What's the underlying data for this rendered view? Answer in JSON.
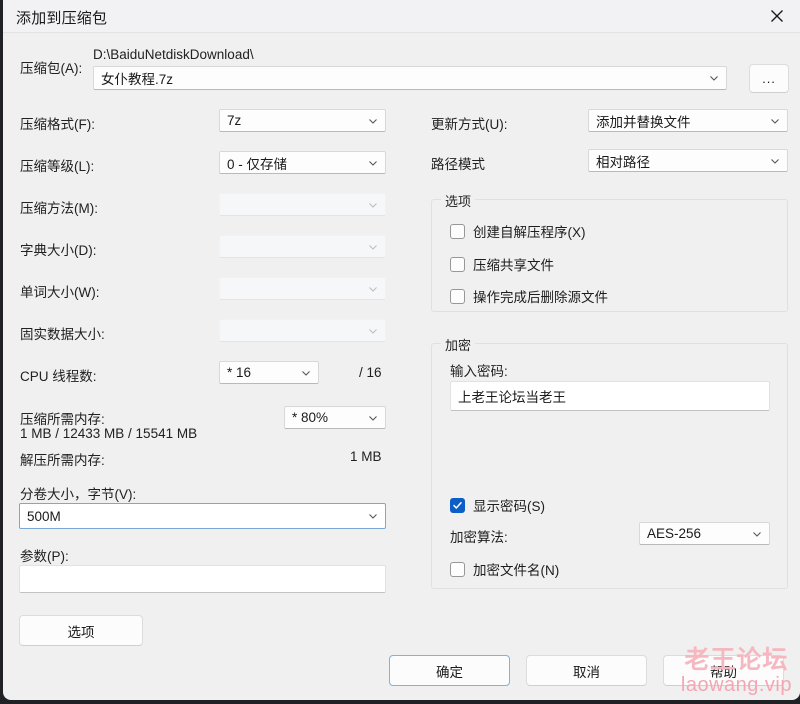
{
  "window": {
    "title": "添加到压缩包",
    "close_icon": "close-icon"
  },
  "archive": {
    "label": "压缩包(A):",
    "path": "D:\\BaiduNetdiskDownload\\",
    "filename": "女仆教程.7z",
    "browse_label": "...",
    "chevron_icon": "chevron-down-icon"
  },
  "left": {
    "format_label": "压缩格式(F):",
    "format_value": "7z",
    "level_label": "压缩等级(L):",
    "level_value": "0 - 仅存储",
    "method_label": "压缩方法(M):",
    "method_value": "",
    "dict_label": "字典大小(D):",
    "dict_value": "",
    "word_label": "单词大小(W):",
    "word_value": "",
    "solid_label": "固实数据大小:",
    "solid_value": "",
    "cpu_label": "CPU 线程数:",
    "cpu_value": "*  16",
    "cpu_total": "/ 16",
    "mem_compress_label": "压缩所需内存:",
    "mem_compress_value": "1 MB / 12433 MB / 15541 MB",
    "mem_percent_value": "*  80%",
    "mem_extract_label": "解压所需内存:",
    "mem_extract_value": "1 MB",
    "volume_label": "分卷大小，字节(V):",
    "volume_value": "500M",
    "params_label": "参数(P):",
    "params_value": "",
    "options_button": "选项"
  },
  "right": {
    "update_label": "更新方式(U):",
    "update_value": "添加并替换文件",
    "path_mode_label": "路径模式",
    "path_mode_value": "相对路径",
    "options_group_title": "选项",
    "options_checkboxes": [
      {
        "label": "创建自解压程序(X)",
        "checked": false
      },
      {
        "label": "压缩共享文件",
        "checked": false
      },
      {
        "label": "操作完成后删除源文件",
        "checked": false
      }
    ],
    "encryption_group_title": "加密",
    "password_label": "输入密码:",
    "password_value": "上老王论坛当老王",
    "show_password_label": "显示密码(S)",
    "show_password_checked": true,
    "algorithm_label": "加密算法:",
    "algorithm_value": "AES-256",
    "encrypt_names_label": "加密文件名(N)",
    "encrypt_names_checked": false
  },
  "footer": {
    "ok_label": "确定",
    "cancel_label": "取消",
    "help_label": "帮助"
  },
  "watermark": {
    "line1": "老王论坛",
    "line2": "laowang.vip",
    "color1": "#f6b8c0",
    "color2": "#f3a7b4"
  }
}
